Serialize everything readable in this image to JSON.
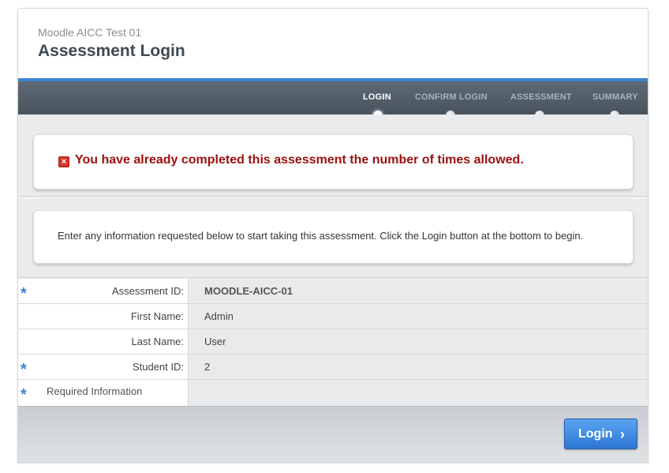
{
  "header": {
    "course_title": "Moodle AICC Test 01",
    "page_title": "Assessment Login"
  },
  "nav": {
    "steps": [
      {
        "label": "LOGIN",
        "active": true
      },
      {
        "label": "CONFIRM LOGIN",
        "active": false
      },
      {
        "label": "ASSESSMENT",
        "active": false
      },
      {
        "label": "SUMMARY",
        "active": false
      }
    ]
  },
  "error": {
    "icon": "error-x-icon",
    "message": "You have already completed this assessment the number of times allowed."
  },
  "info": {
    "message": "Enter any information requested below to start taking this assessment.  Click the Login button at the bottom to begin."
  },
  "form": {
    "rows": [
      {
        "label": "Assessment ID:",
        "value": "MOODLE-AICC-01",
        "required": true
      },
      {
        "label": "First Name:",
        "value": "Admin",
        "required": false
      },
      {
        "label": "Last Name:",
        "value": "User",
        "required": false
      },
      {
        "label": "Student ID:",
        "value": "2",
        "required": true
      }
    ],
    "required_marker": "*",
    "required_note": "Required Information"
  },
  "footer": {
    "login_label": "Login",
    "login_chevron": "›"
  },
  "colors": {
    "accent": "#3c82d4",
    "error": "#9b1010",
    "nav_bg": "#48535d"
  }
}
